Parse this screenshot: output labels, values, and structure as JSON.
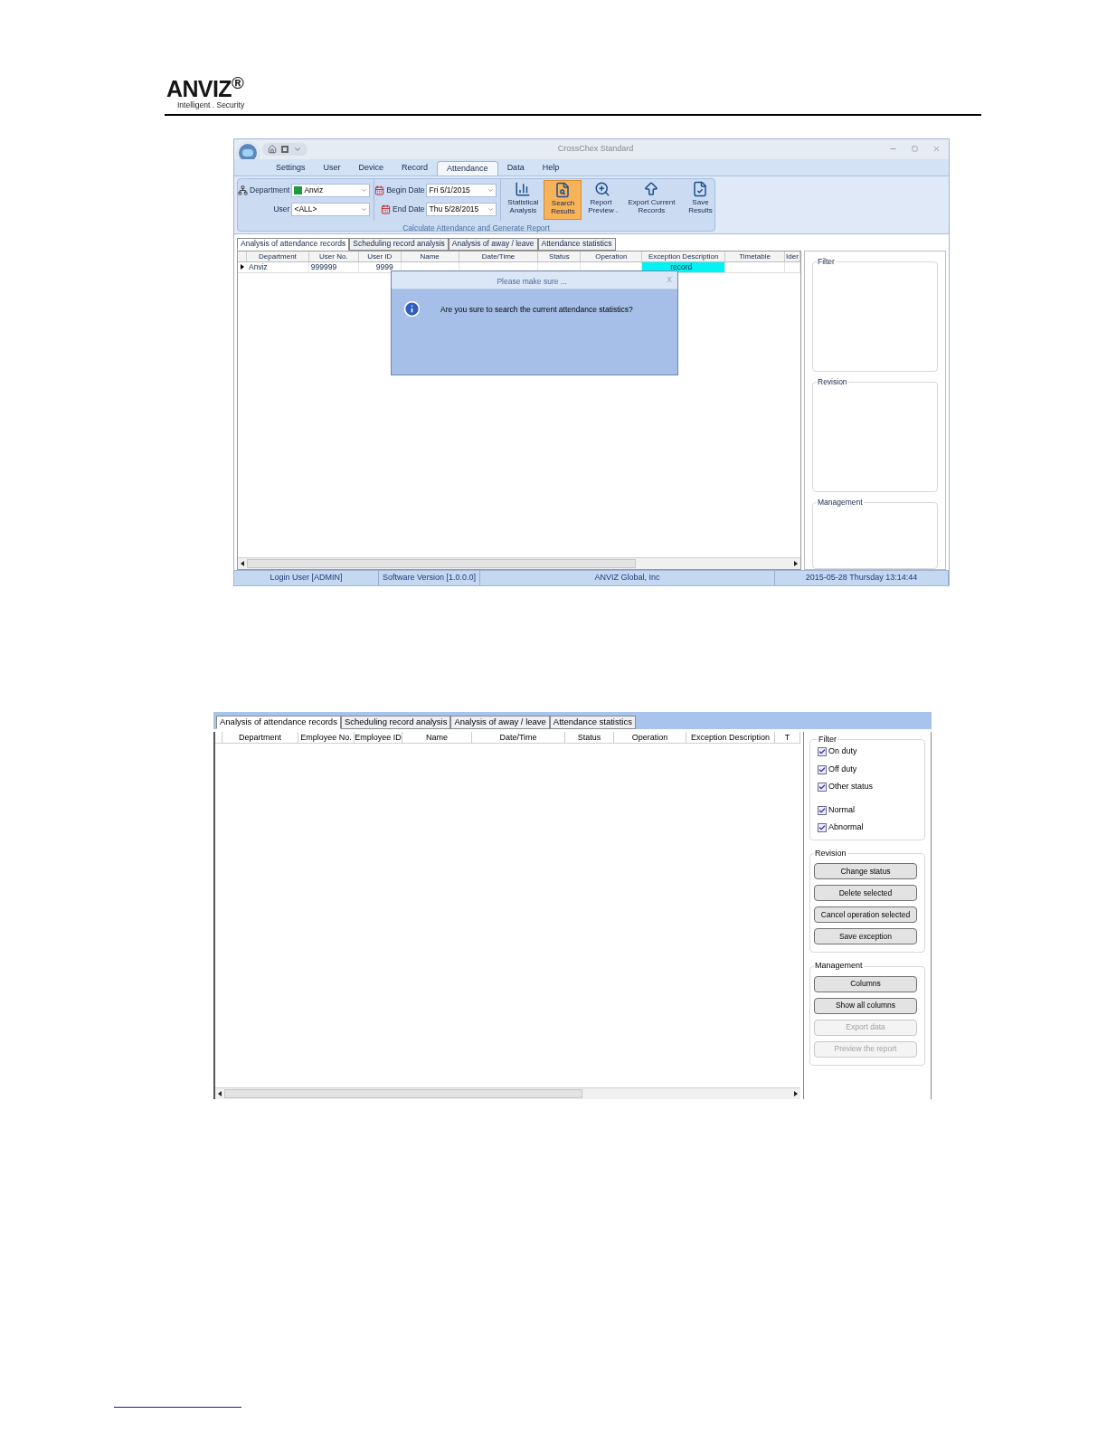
{
  "header": {
    "logo": "ANVIZ$^{®}$",
    "tagline": "Intelligent . Security"
  },
  "screenshot_1": {
    "window": {
      "title": "CrossChex Standard"
    },
    "menu_tabs": [
      {
        "label": "Settings",
        "selected": false
      },
      {
        "label": "User",
        "selected": false
      },
      {
        "label": "Device",
        "selected": false
      },
      {
        "label": "Record",
        "selected": false
      },
      {
        "label": "Attendance",
        "selected": true
      },
      {
        "label": "Data",
        "selected": false
      },
      {
        "label": "Help",
        "selected": false
      }
    ],
    "ribbon": {
      "fields": [
        {
          "kind": "department",
          "label": "Department",
          "value": "Anviz"
        },
        {
          "kind": "user",
          "label": "User",
          "value": "<ALL>"
        },
        {
          "kind": "date",
          "label": "Begin Date",
          "value": "Fri 5/1/2015"
        },
        {
          "kind": "date",
          "label": "End Date",
          "value": "Thu 5/28/2015"
        }
      ],
      "buttons": [
        {
          "kind": "chart",
          "label": "Statistical Analysis",
          "selected": false,
          "dropdown": false
        },
        {
          "kind": "search",
          "label": "Search Results",
          "selected": true,
          "dropdown": false
        },
        {
          "kind": "preview",
          "label": "Report Preview",
          "selected": false,
          "dropdown": true
        },
        {
          "kind": "export",
          "label": "Export Current Records",
          "selected": false,
          "dropdown": false
        },
        {
          "kind": "save",
          "label": "Save Results",
          "selected": false,
          "dropdown": false
        }
      ],
      "group_caption": "Calculate Attendance and Generate Report"
    },
    "tabs": [
      {
        "label": "Analysis of attendance records",
        "selected": true
      },
      {
        "label": "Scheduling record analysis",
        "selected": false
      },
      {
        "label": "Analysis of away / leave",
        "selected": false
      },
      {
        "label": "Attendance statistics",
        "selected": false
      }
    ],
    "table": {
      "columns": [
        "Department",
        "User No.",
        "User ID",
        "Name",
        "Date/Time",
        "Status",
        "Operation",
        "Exception Description",
        "Timetable",
        "Ider"
      ],
      "rows": [
        {
          "cells": [
            "Anviz",
            "999999",
            "9999"
          ],
          "exception_description": "record"
        }
      ]
    },
    "side_groups": [
      "Filter",
      "Revision",
      "Management"
    ],
    "dialog": {
      "title": "Please make sure ...",
      "close": "X",
      "message": "Are you sure to search the current attendance statistics?"
    },
    "status_bar": [
      "Login User [ADMIN]",
      "Software Version [1.0.0.0]",
      "ANVIZ Global, Inc",
      "2015-05-28 Thursday 13:14:44"
    ]
  },
  "screenshot_2": {
    "tabs": [
      {
        "label": "Analysis of attendance records",
        "selected": true
      },
      {
        "label": "Scheduling record analysis",
        "selected": false
      },
      {
        "label": "Analysis of away / leave",
        "selected": false
      },
      {
        "label": "Attendance statistics",
        "selected": false
      }
    ],
    "table": {
      "columns": [
        "Department",
        "Employee No.",
        "Employee ID",
        "Name",
        "Date/Time",
        "Status",
        "Operation",
        "Exception Description",
        "T"
      ]
    },
    "filter": {
      "title": "Filter",
      "options": [
        {
          "label": "On duty",
          "checked": true
        },
        {
          "label": "Off duty",
          "checked": true
        },
        {
          "label": "Other status",
          "checked": true
        },
        {
          "label": "Normal",
          "checked": true
        },
        {
          "label": "Abnormal",
          "checked": true
        }
      ]
    },
    "revision": {
      "title": "Revision",
      "buttons": [
        {
          "label": "Change status",
          "disabled": false
        },
        {
          "label": "Delete selected",
          "disabled": false
        },
        {
          "label": "Cancel operation selected",
          "disabled": false
        },
        {
          "label": "Save exception",
          "disabled": false
        }
      ]
    },
    "management": {
      "title": "Management",
      "buttons": [
        {
          "label": "Columns",
          "disabled": false
        },
        {
          "label": "Show all columns",
          "disabled": false
        },
        {
          "label": "Export data",
          "disabled": true
        },
        {
          "label": "Preview the report",
          "disabled": true
        }
      ]
    }
  }
}
